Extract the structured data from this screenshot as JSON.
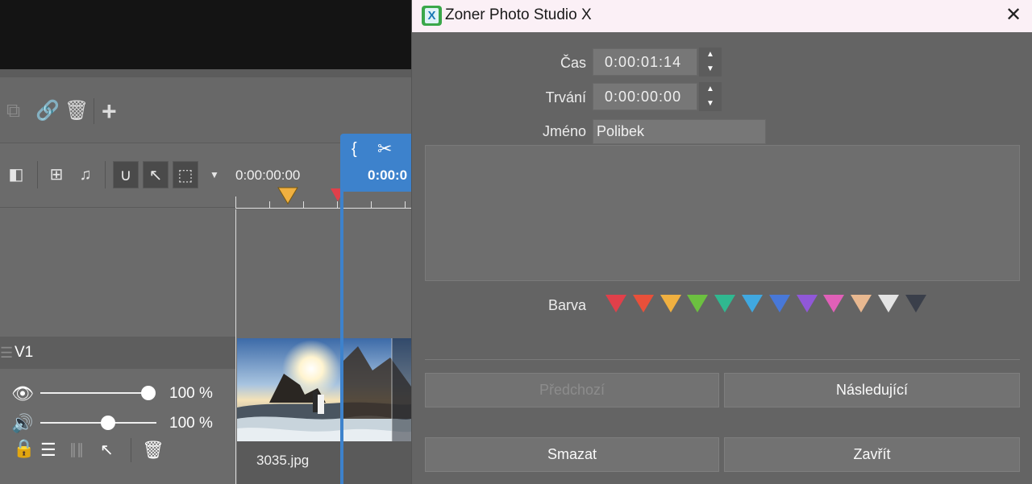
{
  "background": {
    "ruler_time": "0:00:00:00",
    "playhead_time": "0:00:0",
    "track": {
      "name": "V1"
    },
    "video_volume": {
      "value": 1.0,
      "label": "100 %"
    },
    "audio_volume": {
      "value": 0.58,
      "label": "100 %"
    },
    "clip_name": "3035.jpg"
  },
  "dialog": {
    "title": "Zoner Photo Studio X",
    "close_glyph": "✕",
    "fields": {
      "time_label": "Čas",
      "time_value": "0:00:01:14",
      "duration_label": "Trvání",
      "duration_value": "0:00:00:00",
      "name_label": "Jméno",
      "name_value": "Polibek",
      "note_value": ""
    },
    "color_label": "Barva",
    "colors": [
      "#e0404a",
      "#e8503a",
      "#f0b040",
      "#6cc040",
      "#30b890",
      "#40a8e0",
      "#4878d8",
      "#9058d8",
      "#e060b8",
      "#e8b890",
      "#e4e4e4",
      "#3a3f4a"
    ],
    "buttons": {
      "previous": "Předchozí",
      "next": "Následující",
      "delete": "Smazat",
      "close": "Zavřít"
    }
  }
}
